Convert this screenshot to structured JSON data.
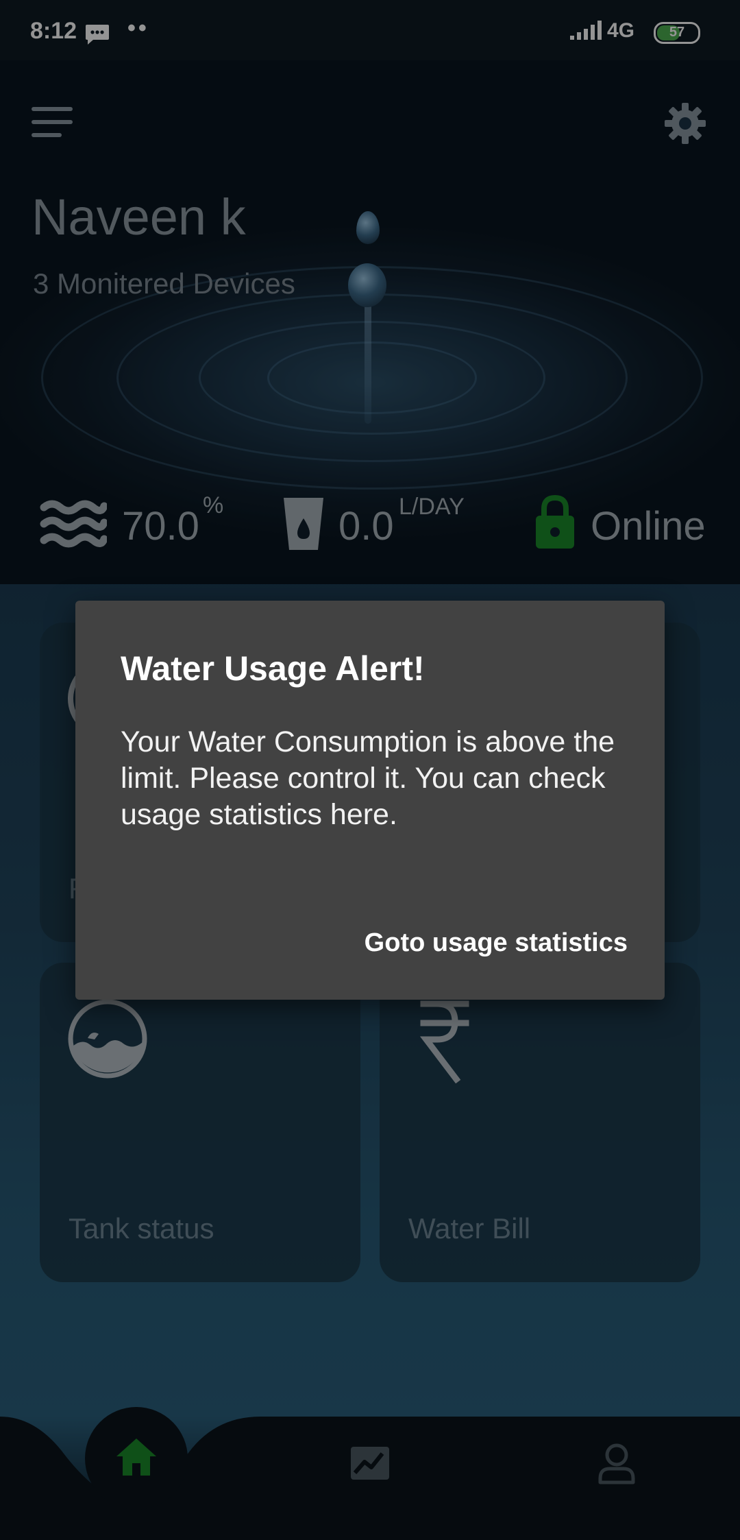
{
  "status_bar": {
    "time": "8:12",
    "network": "4G",
    "battery_level": "57",
    "battery_fraction": 0.57,
    "message_icon": "message-icon",
    "signal_icon": "signal-icon"
  },
  "header": {
    "user_name": "Naveen k",
    "subtitle": "3 Monitered Devices",
    "menu_icon": "hamburger-menu-icon",
    "settings_icon": "gear-icon"
  },
  "stats": {
    "level_value": "70.0",
    "level_unit": "%",
    "usage_value": "0.0",
    "usage_unit": "L/DAY",
    "connection_status": "Online",
    "colors": {
      "online": "#1b8a2a",
      "icon_gray": "#a7b1b8"
    }
  },
  "cards": [
    {
      "label": "F",
      "icon": "gauge-icon"
    },
    {
      "label": "",
      "icon": "unknown-icon"
    },
    {
      "label": "Tank status",
      "icon": "tank-icon"
    },
    {
      "label": "Water Bill",
      "icon": "rupee-icon"
    }
  ],
  "bottom_nav": {
    "items": [
      {
        "name": "home",
        "icon": "home-icon",
        "active": true
      },
      {
        "name": "statistics",
        "icon": "chart-icon",
        "active": false
      },
      {
        "name": "profile",
        "icon": "user-icon",
        "active": false
      }
    ],
    "active_color": "#1b8a2a"
  },
  "dialog": {
    "title": "Water Usage Alert!",
    "message": "Your Water Consumption is above the limit. Please control it. You can check usage statistics here.",
    "action_label": "Goto usage statistics"
  }
}
